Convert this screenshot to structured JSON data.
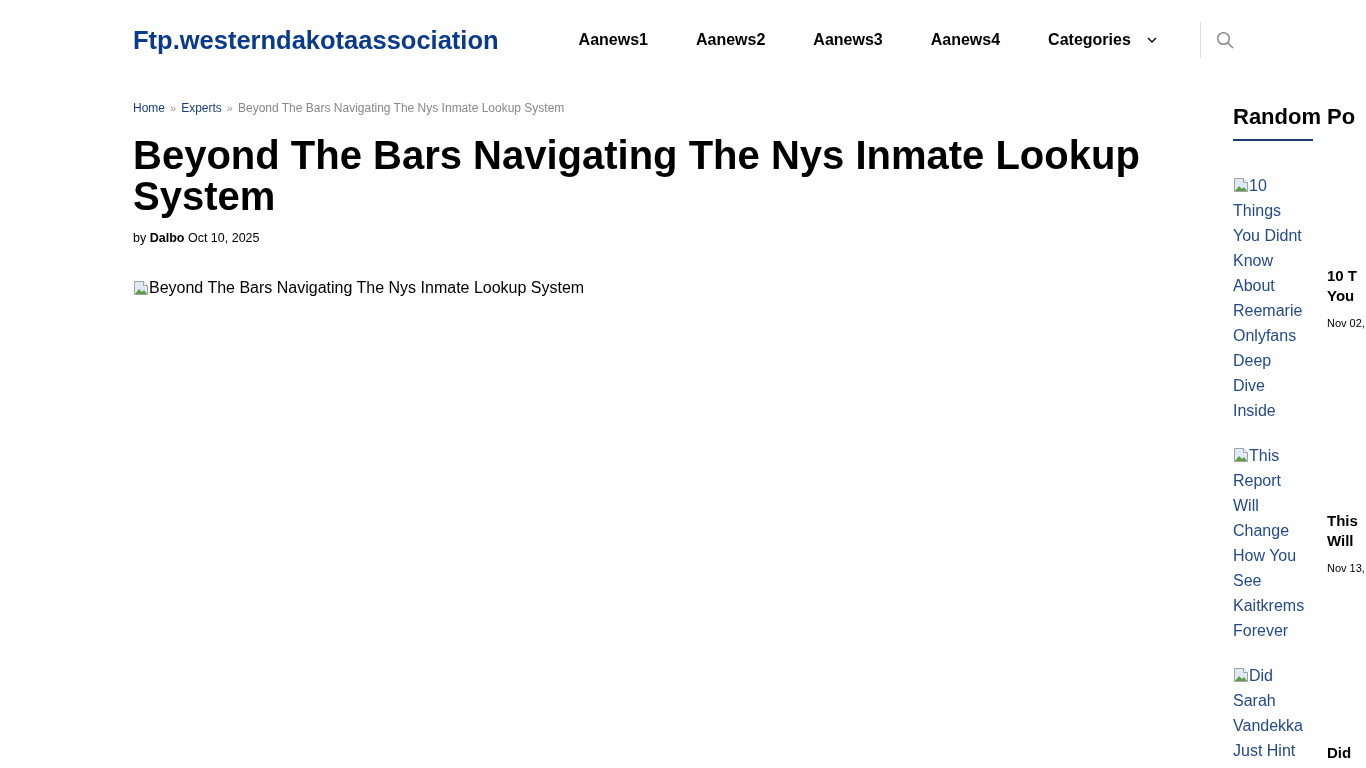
{
  "header": {
    "logo": "Ftp.westerndakotaassociation",
    "nav": [
      {
        "label": "Aanews1",
        "kind": "link"
      },
      {
        "label": "Aanews2",
        "kind": "link"
      },
      {
        "label": "Aanews3",
        "kind": "link"
      },
      {
        "label": "Aanews4",
        "kind": "link"
      },
      {
        "label": "Categories",
        "kind": "dropdown"
      }
    ]
  },
  "breadcrumb": [
    {
      "label": "Home",
      "kind": "link"
    },
    {
      "label": "»",
      "kind": "separator"
    },
    {
      "label": "Experts",
      "kind": "link"
    },
    {
      "label": "»",
      "kind": "separator"
    },
    {
      "label": "Beyond The Bars Navigating The Nys Inmate Lookup System",
      "kind": "current"
    }
  ],
  "article": {
    "title": "Beyond The Bars Navigating The Nys Inmate Lookup System",
    "byline": {
      "prefix": "by",
      "author": "Dalbo",
      "date": "Oct 10, 2025"
    },
    "image_alt": "Beyond The Bars Navigating The Nys Inmate Lookup System"
  },
  "sidebar": {
    "heading": "Random Po",
    "posts": [
      {
        "image_alt": "10 Things You Didnt Know About Reemarie Onlyfans Deep Dive Inside",
        "title_lines": [
          "10 T",
          "You"
        ],
        "date": "Nov 02,"
      },
      {
        "image_alt": "This Report Will Change How You See Kaitkrems Forever",
        "title_lines": [
          "This",
          "Will"
        ],
        "date": "Nov 13,"
      },
      {
        "image_alt": "Did Sarah Vandekka Just Hint",
        "title_lines": [
          "Did"
        ]
      }
    ]
  }
}
